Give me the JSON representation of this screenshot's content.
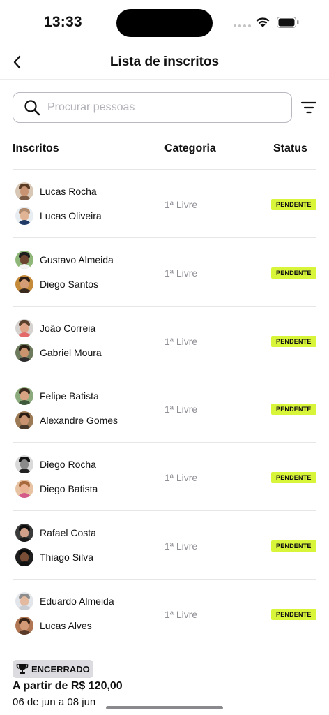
{
  "status_bar": {
    "time": "13:33"
  },
  "header": {
    "title": "Lista de inscritos",
    "back_icon": "chevron-left-icon"
  },
  "search": {
    "placeholder": "Procurar pessoas",
    "value": ""
  },
  "columns": {
    "inscritos": "Inscritos",
    "categoria": "Categoria",
    "status": "Status"
  },
  "rows": [
    {
      "p1": "Lucas Rocha",
      "p2": "Lucas Oliveira",
      "category": "1ª Livre",
      "status": "PENDENTE"
    },
    {
      "p1": "Gustavo Almeida",
      "p2": "Diego Santos",
      "category": "1ª Livre",
      "status": "PENDENTE"
    },
    {
      "p1": "João Correia",
      "p2": "Gabriel Moura",
      "category": "1ª Livre",
      "status": "PENDENTE"
    },
    {
      "p1": "Felipe Batista",
      "p2": "Alexandre Gomes",
      "category": "1ª Livre",
      "status": "PENDENTE"
    },
    {
      "p1": "Diego Rocha",
      "p2": "Diego Batista",
      "category": "1ª Livre",
      "status": "PENDENTE"
    },
    {
      "p1": "Rafael Costa",
      "p2": "Thiago Silva",
      "category": "1ª Livre",
      "status": "PENDENTE"
    },
    {
      "p1": "Eduardo Almeida",
      "p2": "Lucas Alves",
      "category": "1ª Livre",
      "status": "PENDENTE"
    }
  ],
  "footer": {
    "badge": "ENCERRADO",
    "price": "A partir de R$ 120,00",
    "dates": "06 de jun a 08 jun"
  },
  "colors": {
    "status_badge": "#d9f53a",
    "closed_badge": "#dcdce0",
    "category_text": "#8e8e95",
    "divider": "#e6e6e6"
  }
}
